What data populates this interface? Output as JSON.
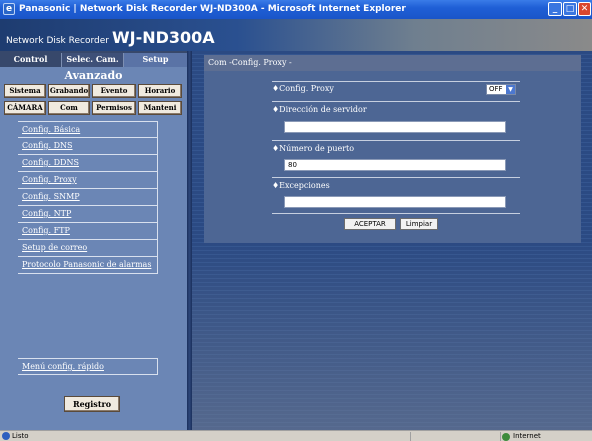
{
  "window": {
    "title": "Panasonic | Network Disk Recorder WJ-ND300A - Microsoft Internet Explorer"
  },
  "header": {
    "brand_small": "Network Disk Recorder",
    "model": "WJ-ND300A"
  },
  "tabs": [
    {
      "label": "Control"
    },
    {
      "label": "Selec. Cam."
    },
    {
      "label": "Setup"
    }
  ],
  "left": {
    "section_title": "Avanzado",
    "categories": [
      "Sistema",
      "Grabando",
      "Evento",
      "Horario",
      "CÁMARA",
      "Com",
      "Permisos",
      "Manteni"
    ],
    "menu": [
      "Config. Básica",
      "Config. DNS",
      "Config. DDNS",
      "Config. Proxy",
      "Config. SNMP",
      "Config. NTP",
      "Config. FTP",
      "Setup de correo",
      "Protocolo Panasonic de alarmas"
    ],
    "quick_menu": "Menú config. rápido",
    "register_button": "Registro"
  },
  "main": {
    "breadcrumb": "Com -Config. Proxy -",
    "proxy_label": "♦Config. Proxy",
    "proxy_value": "OFF",
    "server_label": "♦Dirección de servidor",
    "server_value": "",
    "port_label": "♦Número de puerto",
    "port_value": "80",
    "exceptions_label": "♦Excepciones",
    "exceptions_value": "",
    "accept_button": "ACEPTAR",
    "clear_button": "Limpiar"
  },
  "status": {
    "left": "Listo",
    "zone": "Internet"
  }
}
